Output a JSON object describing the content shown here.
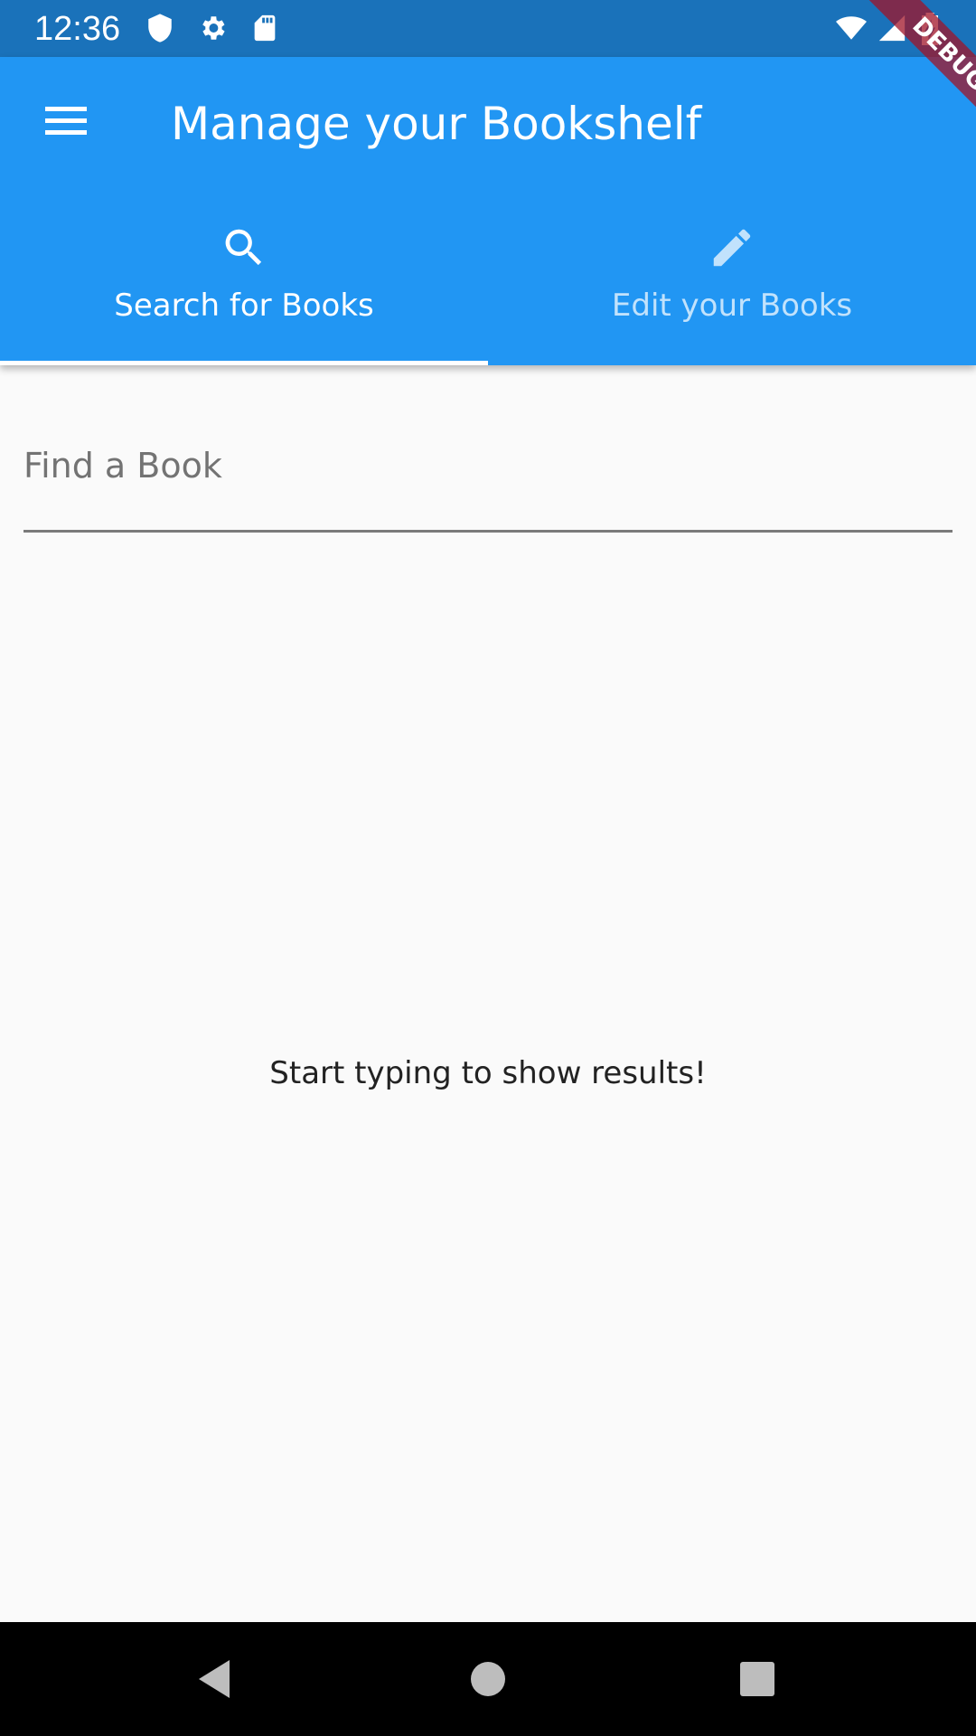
{
  "status_bar": {
    "time": "12:36",
    "left_icons": [
      "shield-icon",
      "settings-icon",
      "sd-card-icon"
    ],
    "right_icons": [
      "wifi-icon",
      "signal-icon",
      "battery-charging-icon"
    ]
  },
  "debug_banner": {
    "label": "DEBUG"
  },
  "app_bar": {
    "title": "Manage your Bookshelf",
    "menu_icon": "menu-icon",
    "color": "#2196f3"
  },
  "tabs": [
    {
      "label": "Search for Books",
      "icon": "search-icon",
      "selected": true
    },
    {
      "label": "Edit your Books",
      "icon": "edit-icon",
      "selected": false
    }
  ],
  "search": {
    "placeholder": "Find a Book",
    "value": ""
  },
  "empty_state": {
    "message": "Start typing to show results!"
  },
  "nav_bar": {
    "buttons": [
      "back-icon",
      "home-icon",
      "recents-icon"
    ]
  }
}
